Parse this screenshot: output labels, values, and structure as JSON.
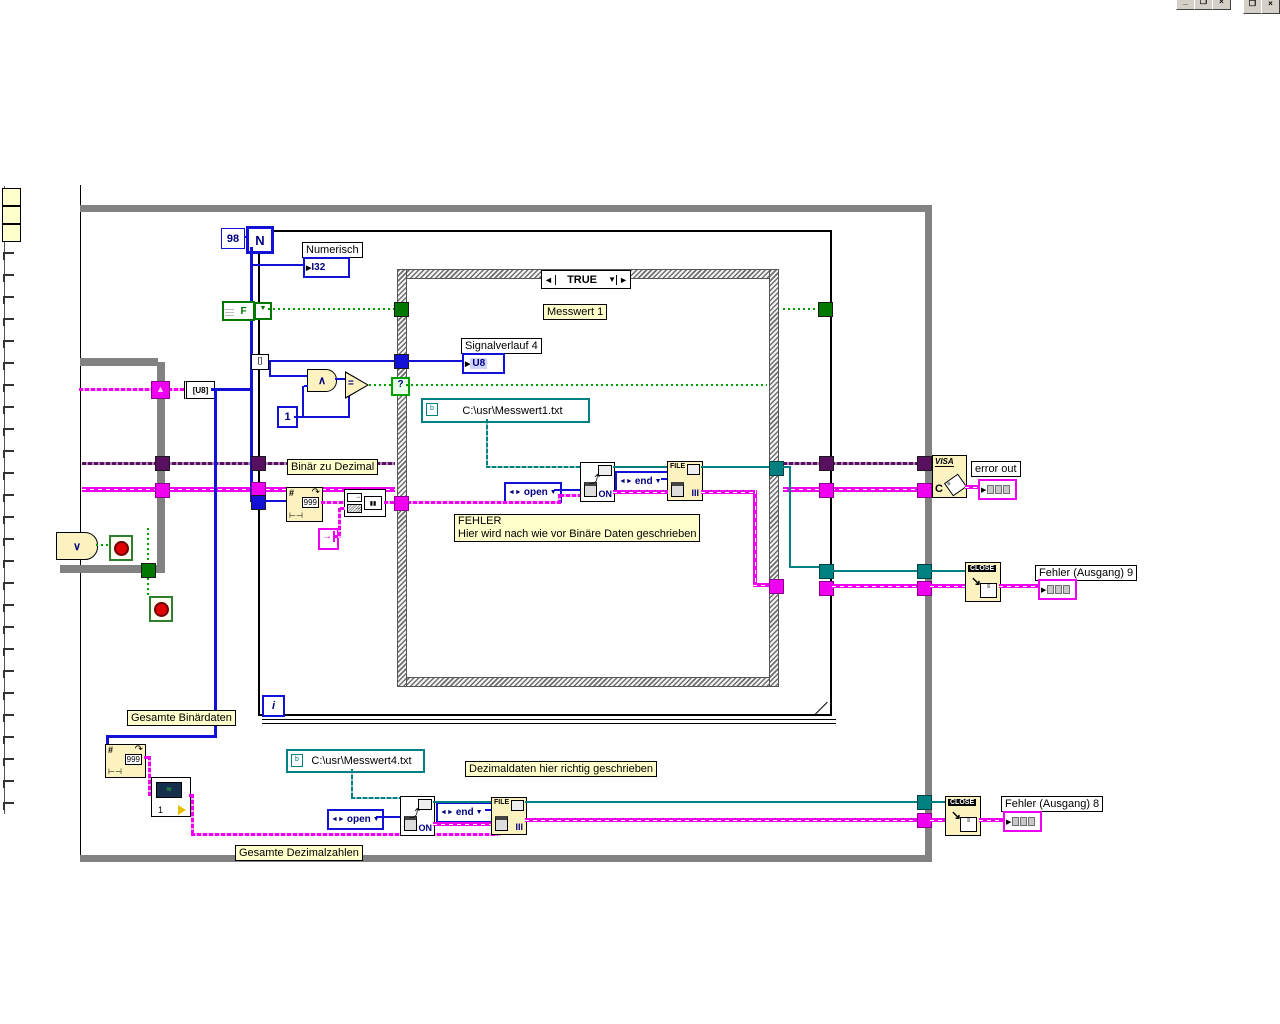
{
  "t": {
    "numerisch": "Numerisch",
    "i32": "I32",
    "u8": "U8",
    "signalverlauf": "Signalverlauf 4",
    "messwert": "Messwert 1",
    "binaer": "Binär zu Dezimal",
    "fehler_line1": "FEHLER",
    "fehler_line2": "Hier wird nach wie vor Binäre Daten geschrieben",
    "gesbin": "Gesamte Binärdaten",
    "gesdez": "Gesamte Dezimalzahlen",
    "dezok": "Dezimaldaten hier richtig geschrieben",
    "errorout": "error out",
    "fehler9": "Fehler (Ausgang) 9",
    "fehler8": "Fehler (Ausgang) 8",
    "case_true": "TRUE",
    "n": "N",
    "i": "i",
    "c98": "98",
    "c1": "1",
    "f": "F",
    "u8arr": "[U8]",
    "n999": "999",
    "hash": "#",
    "open": "open",
    "end": "end",
    "file": "FILE",
    "close": "CLOSE",
    "visa": "VISA",
    "c": "C",
    "on": "ON",
    "bars": "III",
    "brackets": "[]",
    "q": "?",
    "path1": "C:\\usr\\Messwert1.txt",
    "path2": "C:\\usr\\Messwert4.txt"
  },
  "icons": {
    "and": "∧",
    "or": "∨",
    "eq": "=",
    "up": "▲",
    "down": "▼",
    "left": "◄",
    "right": "►",
    "play": "▶",
    "minimize": "_",
    "restore": "❐",
    "close_x": "×",
    "hspan": "⊢⊣",
    "curve": "↷",
    "diag": "↘",
    "squig": "≈",
    "tab": "→",
    "swap": "◄►"
  },
  "colors": {
    "wire_blue": "#1212d6",
    "wire_teal": "#008080",
    "wire_magenta": "#f000f0",
    "wire_purple": "#5a1060",
    "wire_green": "#00a000",
    "label_yellow": "#ffffcc",
    "node_cream": "#fbf2c0",
    "border_gray": "#828282"
  }
}
